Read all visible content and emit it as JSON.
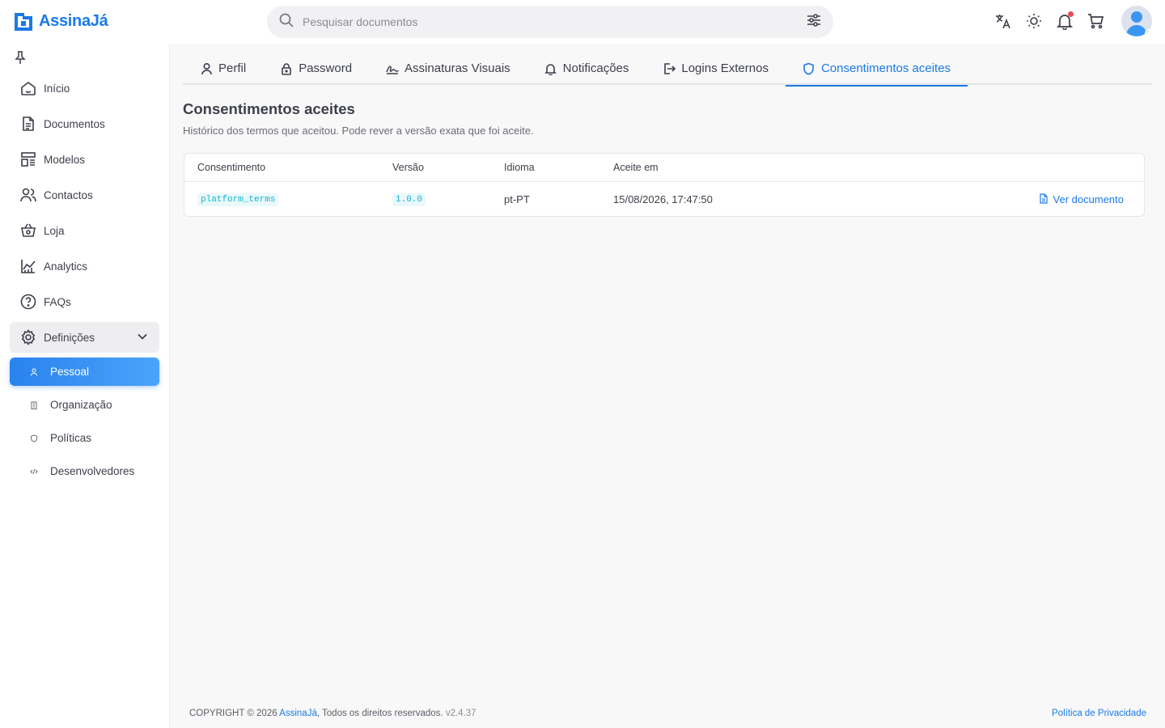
{
  "app": {
    "brand": "AssinaJá"
  },
  "search": {
    "placeholder": "Pesquisar documentos"
  },
  "topbar": {
    "icons": [
      "translate-icon",
      "theme-sun-icon",
      "bell-icon",
      "cart-icon"
    ],
    "notification_badge_color": "#ee4b57",
    "online_status_color": "#2ec26a"
  },
  "sidebar": {
    "items": [
      {
        "label": "Início",
        "icon": "home-icon"
      },
      {
        "label": "Documentos",
        "icon": "document-icon"
      },
      {
        "label": "Modelos",
        "icon": "templates-icon"
      },
      {
        "label": "Contactos",
        "icon": "contacts-icon"
      },
      {
        "label": "Loja",
        "icon": "basket-icon"
      },
      {
        "label": "Analytics",
        "icon": "analytics-icon"
      },
      {
        "label": "FAQs",
        "icon": "help-icon"
      }
    ],
    "group": {
      "label": "Definições",
      "icon": "gear-icon"
    },
    "subitems": [
      {
        "label": "Pessoal",
        "icon": "user-icon",
        "active": true
      },
      {
        "label": "Organização",
        "icon": "building-icon"
      },
      {
        "label": "Políticas",
        "icon": "shield-icon"
      },
      {
        "label": "Desenvolvedores",
        "icon": "code-icon"
      }
    ]
  },
  "tabs": [
    {
      "label": "Perfil",
      "icon": "user-icon"
    },
    {
      "label": "Password",
      "icon": "lock-icon"
    },
    {
      "label": "Assinaturas Visuais",
      "icon": "signature-icon"
    },
    {
      "label": "Notificações",
      "icon": "bell-icon"
    },
    {
      "label": "Logins Externos",
      "icon": "login-icon"
    },
    {
      "label": "Consentimentos aceites",
      "icon": "shield-icon",
      "active": true
    }
  ],
  "page": {
    "title": "Consentimentos aceites",
    "subtitle": "Histórico dos termos que aceitou. Pode rever a versão exata que foi aceite."
  },
  "table": {
    "headers": [
      "Consentimento",
      "Versão",
      "Idioma",
      "Aceite em"
    ],
    "rows": [
      {
        "consent": "platform_terms",
        "version": "1.0.0",
        "language": "pt-PT",
        "accepted_at": "15/08/2026, 17:47:50",
        "action": "Ver documento"
      }
    ]
  },
  "footer": {
    "prefix": "COPYRIGHT © 2026 ",
    "brand": "AssinaJá",
    "suffix": ", Todos os direitos reservados.",
    "version": "v2.4.37",
    "privacy": "Política de Privacidade"
  },
  "colors": {
    "accent": "#1a7ae8",
    "code_badge": "#17b4cf"
  }
}
